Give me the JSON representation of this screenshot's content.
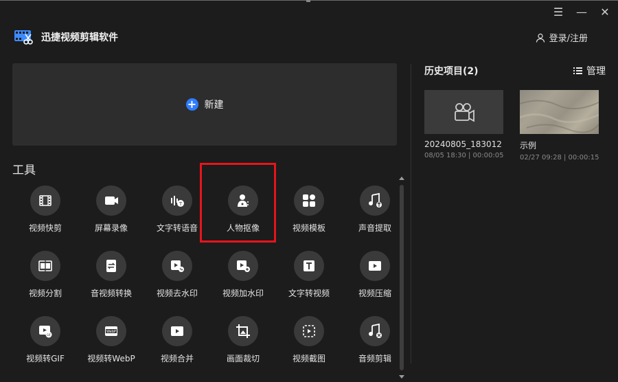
{
  "app": {
    "title": "迅捷视频剪辑软件",
    "accent": "#2e7dff",
    "highlight_color": "#e8141b"
  },
  "window_controls": [
    {
      "icon": "menu-icon",
      "glyph": "☰"
    },
    {
      "icon": "minimize-icon",
      "glyph": "—"
    },
    {
      "icon": "close-icon",
      "glyph": "✕"
    }
  ],
  "header": {
    "login_label": "登录/注册"
  },
  "new_project": {
    "label": "新建"
  },
  "tools_section": {
    "title": "工具",
    "items": [
      {
        "label": "视频快剪",
        "icon": "film-strip-icon"
      },
      {
        "label": "屏幕录像",
        "icon": "screen-record-icon"
      },
      {
        "label": "文字转语音",
        "icon": "text-to-speech-icon"
      },
      {
        "label": "人物抠像",
        "icon": "portrait-cutout-icon"
      },
      {
        "label": "视频模板",
        "icon": "template-icon"
      },
      {
        "label": "声音提取",
        "icon": "audio-extract-icon"
      },
      {
        "label": "视频分割",
        "icon": "video-split-icon"
      },
      {
        "label": "音视频转换",
        "icon": "av-convert-icon"
      },
      {
        "label": "视频去水印",
        "icon": "remove-watermark-icon"
      },
      {
        "label": "视频加水印",
        "icon": "add-watermark-icon"
      },
      {
        "label": "文字转视频",
        "icon": "text-to-video-icon"
      },
      {
        "label": "视频压缩",
        "icon": "video-compress-icon"
      },
      {
        "label": "视频转GIF",
        "icon": "video-to-gif-icon"
      },
      {
        "label": "视频转WebP",
        "icon": "video-to-webp-icon"
      },
      {
        "label": "视频合并",
        "icon": "video-merge-icon"
      },
      {
        "label": "画面裁切",
        "icon": "crop-icon"
      },
      {
        "label": "视频截图",
        "icon": "video-screenshot-icon"
      },
      {
        "label": "音频剪辑",
        "icon": "audio-cut-icon"
      }
    ]
  },
  "history": {
    "title": "历史项目(2)",
    "manage_label": "管理",
    "projects": [
      {
        "name": "20240805_183012",
        "meta": "08/05 18:30 | 00:00:05",
        "thumb": "camera-placeholder-icon"
      },
      {
        "name": "示例",
        "meta": "02/27 09:28 | 00:00:15",
        "thumb": "desert-landscape-image"
      }
    ]
  }
}
